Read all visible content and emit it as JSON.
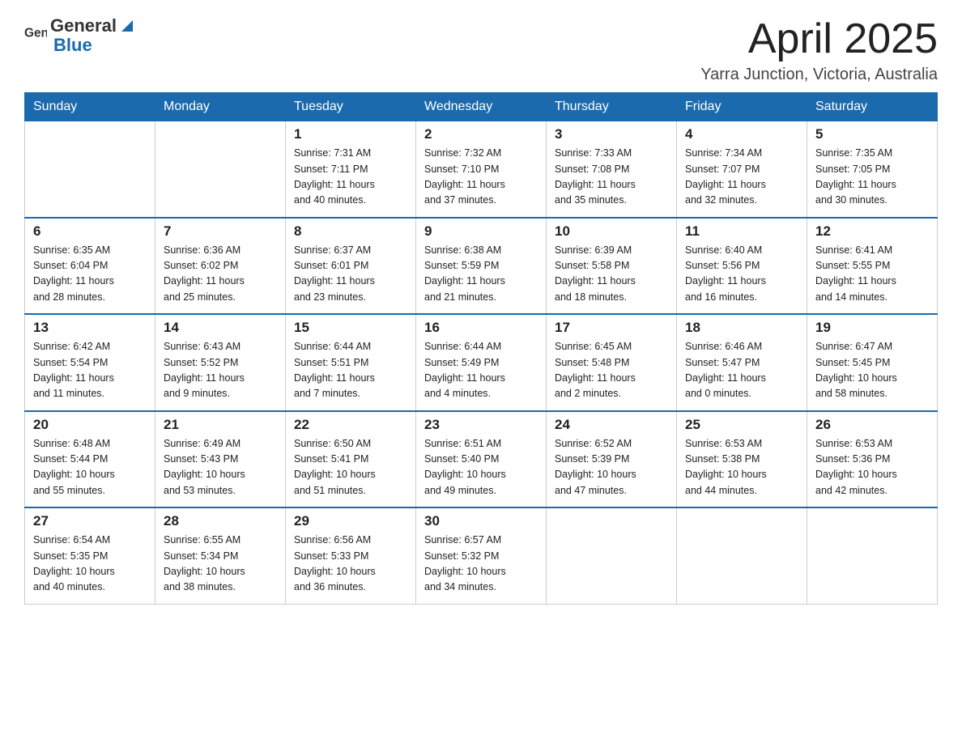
{
  "logo": {
    "text_general": "General",
    "text_blue": "Blue"
  },
  "title": {
    "month_year": "April 2025",
    "location": "Yarra Junction, Victoria, Australia"
  },
  "weekdays": [
    "Sunday",
    "Monday",
    "Tuesday",
    "Wednesday",
    "Thursday",
    "Friday",
    "Saturday"
  ],
  "weeks": [
    [
      {
        "day": "",
        "info": ""
      },
      {
        "day": "",
        "info": ""
      },
      {
        "day": "1",
        "info": "Sunrise: 7:31 AM\nSunset: 7:11 PM\nDaylight: 11 hours\nand 40 minutes."
      },
      {
        "day": "2",
        "info": "Sunrise: 7:32 AM\nSunset: 7:10 PM\nDaylight: 11 hours\nand 37 minutes."
      },
      {
        "day": "3",
        "info": "Sunrise: 7:33 AM\nSunset: 7:08 PM\nDaylight: 11 hours\nand 35 minutes."
      },
      {
        "day": "4",
        "info": "Sunrise: 7:34 AM\nSunset: 7:07 PM\nDaylight: 11 hours\nand 32 minutes."
      },
      {
        "day": "5",
        "info": "Sunrise: 7:35 AM\nSunset: 7:05 PM\nDaylight: 11 hours\nand 30 minutes."
      }
    ],
    [
      {
        "day": "6",
        "info": "Sunrise: 6:35 AM\nSunset: 6:04 PM\nDaylight: 11 hours\nand 28 minutes."
      },
      {
        "day": "7",
        "info": "Sunrise: 6:36 AM\nSunset: 6:02 PM\nDaylight: 11 hours\nand 25 minutes."
      },
      {
        "day": "8",
        "info": "Sunrise: 6:37 AM\nSunset: 6:01 PM\nDaylight: 11 hours\nand 23 minutes."
      },
      {
        "day": "9",
        "info": "Sunrise: 6:38 AM\nSunset: 5:59 PM\nDaylight: 11 hours\nand 21 minutes."
      },
      {
        "day": "10",
        "info": "Sunrise: 6:39 AM\nSunset: 5:58 PM\nDaylight: 11 hours\nand 18 minutes."
      },
      {
        "day": "11",
        "info": "Sunrise: 6:40 AM\nSunset: 5:56 PM\nDaylight: 11 hours\nand 16 minutes."
      },
      {
        "day": "12",
        "info": "Sunrise: 6:41 AM\nSunset: 5:55 PM\nDaylight: 11 hours\nand 14 minutes."
      }
    ],
    [
      {
        "day": "13",
        "info": "Sunrise: 6:42 AM\nSunset: 5:54 PM\nDaylight: 11 hours\nand 11 minutes."
      },
      {
        "day": "14",
        "info": "Sunrise: 6:43 AM\nSunset: 5:52 PM\nDaylight: 11 hours\nand 9 minutes."
      },
      {
        "day": "15",
        "info": "Sunrise: 6:44 AM\nSunset: 5:51 PM\nDaylight: 11 hours\nand 7 minutes."
      },
      {
        "day": "16",
        "info": "Sunrise: 6:44 AM\nSunset: 5:49 PM\nDaylight: 11 hours\nand 4 minutes."
      },
      {
        "day": "17",
        "info": "Sunrise: 6:45 AM\nSunset: 5:48 PM\nDaylight: 11 hours\nand 2 minutes."
      },
      {
        "day": "18",
        "info": "Sunrise: 6:46 AM\nSunset: 5:47 PM\nDaylight: 11 hours\nand 0 minutes."
      },
      {
        "day": "19",
        "info": "Sunrise: 6:47 AM\nSunset: 5:45 PM\nDaylight: 10 hours\nand 58 minutes."
      }
    ],
    [
      {
        "day": "20",
        "info": "Sunrise: 6:48 AM\nSunset: 5:44 PM\nDaylight: 10 hours\nand 55 minutes."
      },
      {
        "day": "21",
        "info": "Sunrise: 6:49 AM\nSunset: 5:43 PM\nDaylight: 10 hours\nand 53 minutes."
      },
      {
        "day": "22",
        "info": "Sunrise: 6:50 AM\nSunset: 5:41 PM\nDaylight: 10 hours\nand 51 minutes."
      },
      {
        "day": "23",
        "info": "Sunrise: 6:51 AM\nSunset: 5:40 PM\nDaylight: 10 hours\nand 49 minutes."
      },
      {
        "day": "24",
        "info": "Sunrise: 6:52 AM\nSunset: 5:39 PM\nDaylight: 10 hours\nand 47 minutes."
      },
      {
        "day": "25",
        "info": "Sunrise: 6:53 AM\nSunset: 5:38 PM\nDaylight: 10 hours\nand 44 minutes."
      },
      {
        "day": "26",
        "info": "Sunrise: 6:53 AM\nSunset: 5:36 PM\nDaylight: 10 hours\nand 42 minutes."
      }
    ],
    [
      {
        "day": "27",
        "info": "Sunrise: 6:54 AM\nSunset: 5:35 PM\nDaylight: 10 hours\nand 40 minutes."
      },
      {
        "day": "28",
        "info": "Sunrise: 6:55 AM\nSunset: 5:34 PM\nDaylight: 10 hours\nand 38 minutes."
      },
      {
        "day": "29",
        "info": "Sunrise: 6:56 AM\nSunset: 5:33 PM\nDaylight: 10 hours\nand 36 minutes."
      },
      {
        "day": "30",
        "info": "Sunrise: 6:57 AM\nSunset: 5:32 PM\nDaylight: 10 hours\nand 34 minutes."
      },
      {
        "day": "",
        "info": ""
      },
      {
        "day": "",
        "info": ""
      },
      {
        "day": "",
        "info": ""
      }
    ]
  ]
}
